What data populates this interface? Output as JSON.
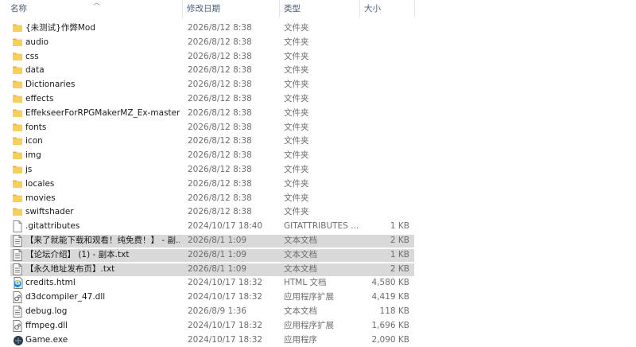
{
  "columns": {
    "name": "名称",
    "date": "修改日期",
    "type": "类型",
    "size": "大小"
  },
  "files": [
    {
      "name": "{未测试}作弊Mod",
      "date": "2026/8/12 8:38",
      "type": "文件夹",
      "size": "",
      "icon": "folder-icon",
      "selected": false
    },
    {
      "name": "audio",
      "date": "2026/8/12 8:38",
      "type": "文件夹",
      "size": "",
      "icon": "folder-icon",
      "selected": false
    },
    {
      "name": "css",
      "date": "2026/8/12 8:38",
      "type": "文件夹",
      "size": "",
      "icon": "folder-icon",
      "selected": false
    },
    {
      "name": "data",
      "date": "2026/8/12 8:38",
      "type": "文件夹",
      "size": "",
      "icon": "folder-icon",
      "selected": false
    },
    {
      "name": "Dictionaries",
      "date": "2026/8/12 8:38",
      "type": "文件夹",
      "size": "",
      "icon": "folder-icon",
      "selected": false
    },
    {
      "name": "effects",
      "date": "2026/8/12 8:38",
      "type": "文件夹",
      "size": "",
      "icon": "folder-icon",
      "selected": false
    },
    {
      "name": "EffekseerForRPGMakerMZ_Ex-master",
      "date": "2026/8/12 8:38",
      "type": "文件夹",
      "size": "",
      "icon": "folder-icon",
      "selected": false
    },
    {
      "name": "fonts",
      "date": "2026/8/12 8:38",
      "type": "文件夹",
      "size": "",
      "icon": "folder-icon",
      "selected": false
    },
    {
      "name": "icon",
      "date": "2026/8/12 8:38",
      "type": "文件夹",
      "size": "",
      "icon": "folder-icon",
      "selected": false
    },
    {
      "name": "img",
      "date": "2026/8/12 8:38",
      "type": "文件夹",
      "size": "",
      "icon": "folder-icon",
      "selected": false
    },
    {
      "name": "js",
      "date": "2026/8/12 8:38",
      "type": "文件夹",
      "size": "",
      "icon": "folder-icon",
      "selected": false
    },
    {
      "name": "locales",
      "date": "2026/8/12 8:38",
      "type": "文件夹",
      "size": "",
      "icon": "folder-icon",
      "selected": false
    },
    {
      "name": "movies",
      "date": "2026/8/12 8:38",
      "type": "文件夹",
      "size": "",
      "icon": "folder-icon",
      "selected": false
    },
    {
      "name": "swiftshader",
      "date": "2026/8/12 8:38",
      "type": "文件夹",
      "size": "",
      "icon": "folder-icon",
      "selected": false
    },
    {
      "name": ".gitattributes",
      "date": "2024/10/17 18:40",
      "type": "GITATTRIBUTES ...",
      "size": "1 KB",
      "icon": "file-icon",
      "selected": false
    },
    {
      "name": "【来了就能下载和观看！纯免费！】 - 副...",
      "date": "2026/8/1 1:09",
      "type": "文本文档",
      "size": "2 KB",
      "icon": "text-file-icon",
      "selected": true
    },
    {
      "name": "【论坛介绍】 (1) - 副本.txt",
      "date": "2026/8/1 1:09",
      "type": "文本文档",
      "size": "1 KB",
      "icon": "text-file-icon",
      "selected": true
    },
    {
      "name": "【永久地址发布页】.txt",
      "date": "2026/8/1 1:09",
      "type": "文本文档",
      "size": "2 KB",
      "icon": "text-file-icon",
      "selected": true
    },
    {
      "name": "credits.html",
      "date": "2024/10/17 18:32",
      "type": "HTML 文档",
      "size": "4,580 KB",
      "icon": "html-file-icon",
      "selected": false
    },
    {
      "name": "d3dcompiler_47.dll",
      "date": "2024/10/17 18:32",
      "type": "应用程序扩展",
      "size": "4,419 KB",
      "icon": "dll-file-icon",
      "selected": false
    },
    {
      "name": "debug.log",
      "date": "2026/8/9 1:36",
      "type": "文本文档",
      "size": "118 KB",
      "icon": "text-file-icon",
      "selected": false
    },
    {
      "name": "ffmpeg.dll",
      "date": "2024/10/17 18:32",
      "type": "应用程序扩展",
      "size": "1,696 KB",
      "icon": "dll-file-icon",
      "selected": false
    },
    {
      "name": "Game.exe",
      "date": "2024/10/17 18:32",
      "type": "应用程序",
      "size": "2,090 KB",
      "icon": "app-icon",
      "selected": false
    }
  ],
  "colors": {
    "folder": "#f4c64f",
    "selection": "#d9d9d9",
    "header_text": "#4c607a"
  }
}
